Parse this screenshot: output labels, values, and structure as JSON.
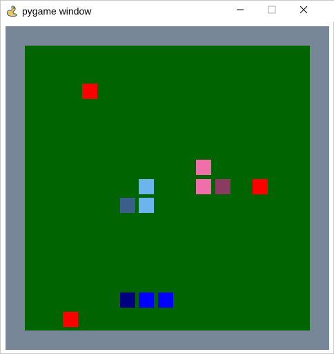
{
  "window": {
    "title": "pygame window"
  },
  "icons": {
    "app": "pygame-snake-icon",
    "minimize": "minimize-icon",
    "maximize": "maximize-icon",
    "close": "close-icon"
  },
  "colors": {
    "border": "#788797",
    "field": "#006400",
    "food": "#ff0000",
    "pink": "#f06ea9",
    "pink_dark": "#8b3a62",
    "light_blue": "#6cb4ee",
    "steel_blue": "#3b5f8a",
    "blue": "#0000ff",
    "navy": "#000080"
  }
}
